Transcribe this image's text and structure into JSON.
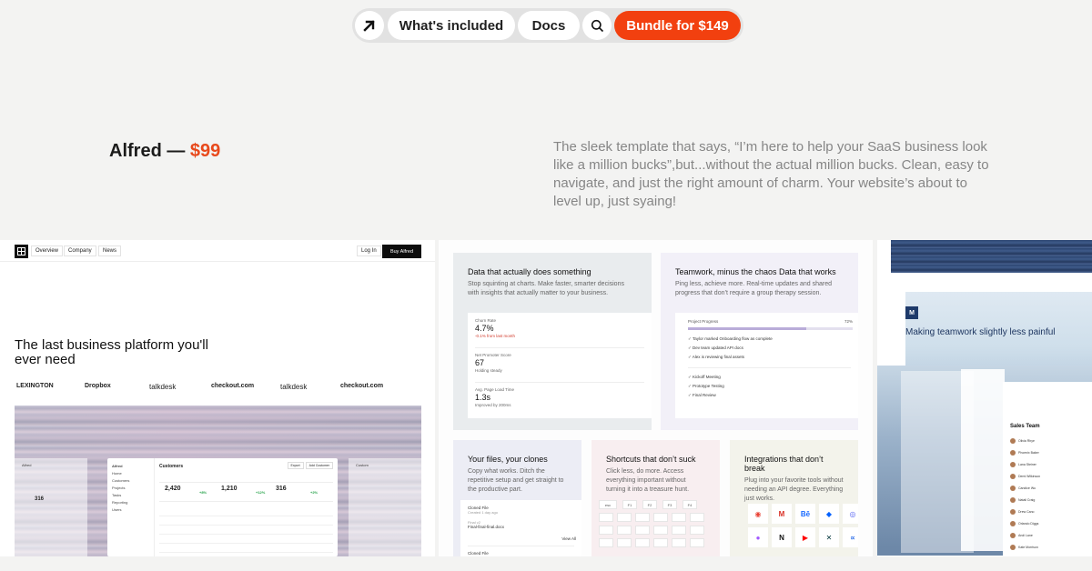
{
  "nav": {
    "logo_icon": "arrow-up-right-icon",
    "whats_included": "What's included",
    "docs": "Docs",
    "search_icon": "search-icon",
    "bundle": "Bundle for $149",
    "accent": "#f2400f"
  },
  "heading": {
    "name": "Alfred — ",
    "price": "$99",
    "description": "The sleek template that says, “I’m here to help your SaaS business look like a million bucks”,but...without the actual million bucks. Clean, easy to navigate, and just the right amount of charm. Your website’s about to level up, just syaing!"
  },
  "site_mock": {
    "nav_links": [
      "Overview",
      "Company",
      "News"
    ],
    "login": "Log In",
    "buy": "Buy Alfred",
    "hero": "The last business platform you'll ever need",
    "logos": [
      "LEXINGTON",
      "Dropbox",
      "talkdesk",
      "checkout.com",
      "talkdesk",
      "checkout.com"
    ],
    "app": {
      "brand": "Alfred",
      "sidebar": [
        "Home",
        "Customers",
        "Projects",
        "Tasks",
        "Reporting",
        "Users"
      ],
      "title": "Customers",
      "buttons": [
        "Export",
        "Add Customer"
      ],
      "stats": [
        "2,420",
        "1,210",
        "316"
      ],
      "stat_deltas": [
        "+8%",
        "+12%",
        "+2%"
      ],
      "side_left_label": "Alfred",
      "side_left_num": "316",
      "side_right_label": "Custom"
    }
  },
  "features": {
    "data": {
      "title": "Data that actually does something",
      "text": "Stop squinting at charts. Make faster, smarter decisions with insights that actually matter to your business.",
      "stats": [
        {
          "label": "Churn Rate",
          "value": "4.7%",
          "note": "-0.1% from last month"
        },
        {
          "label": "Net Promoter Score",
          "value": "67",
          "note": "Holding steady"
        },
        {
          "label": "Avg. Page Load Time",
          "value": "1.3s",
          "note": "Improved by 200ms"
        }
      ]
    },
    "team": {
      "title": "Teamwork, minus the chaos Data that works",
      "text": "Ping less, achieve more. Real-time updates and shared progress that don’t require a group therapy session.",
      "progress_label": "Project Progress",
      "progress_value": "72%",
      "progress": 0.72,
      "activity": [
        "Taylor marked Onboarding flow as complete",
        "Dev team updated API docs",
        "Alex is reviewing final assets"
      ],
      "tasks": [
        "Kickoff Meeting",
        "Prototype Testing",
        "Final Review"
      ]
    },
    "files": {
      "title": "Your files, your clones",
      "text": "Copy what works. Ditch the repetitive setup and get straight to the productive part.",
      "file1": "Cloned File",
      "file1_sub": "Created 1 day ago",
      "file2_sub": "Final v2",
      "file2": "Final-final-final.docx",
      "view_all": "View All",
      "file3": "Cloned File"
    },
    "shortcuts": {
      "title": "Shortcuts that don’t suck",
      "text": "Click less, do more. Access everything important without turning it into a treasure hunt.",
      "keys": [
        "esc",
        "F1",
        "F2",
        "F3",
        "F4"
      ]
    },
    "integrations": {
      "title": "Integrations that don’t break",
      "text": "Plug into your favorite tools without needing an API degree. Everything just works.",
      "icons": [
        "chrome-icon",
        "gmail-icon",
        "behance-icon",
        "dropbox-icon",
        "discord-icon",
        "figma-icon",
        "notion-icon",
        "youtube-icon",
        "zendesk-icon",
        "sketch-icon"
      ]
    }
  },
  "teamwork_mock": {
    "logo": "M",
    "title": "Making teamwork slightly less painful",
    "team_name": "Sales Team",
    "members": [
      "Olivia Rhye",
      "Phoenix Baker",
      "Lana Steiner",
      "Demi Wilkinson",
      "Candice Wu",
      "Natali Craig",
      "Drew Cano",
      "Orlando Diggs",
      "Andi Lane",
      "Kate Morrison"
    ]
  }
}
